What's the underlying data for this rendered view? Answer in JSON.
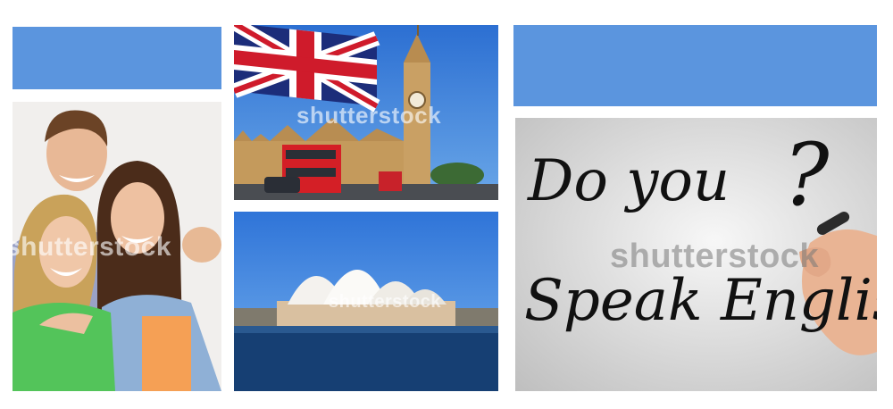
{
  "panels": {
    "top_left_bar": {
      "color": "#5b95de"
    },
    "top_right_bar": {
      "color": "#5b95de"
    },
    "students_photo": {
      "watermark": "shutterstock"
    },
    "london_photo": {
      "watermark": "shutterstock"
    },
    "sydney_photo": {
      "watermark": "shutterstock"
    },
    "board_photo": {
      "line1": "Do you",
      "question_mark": "?",
      "line2": "Speak English",
      "watermark": "shutterstock"
    }
  }
}
